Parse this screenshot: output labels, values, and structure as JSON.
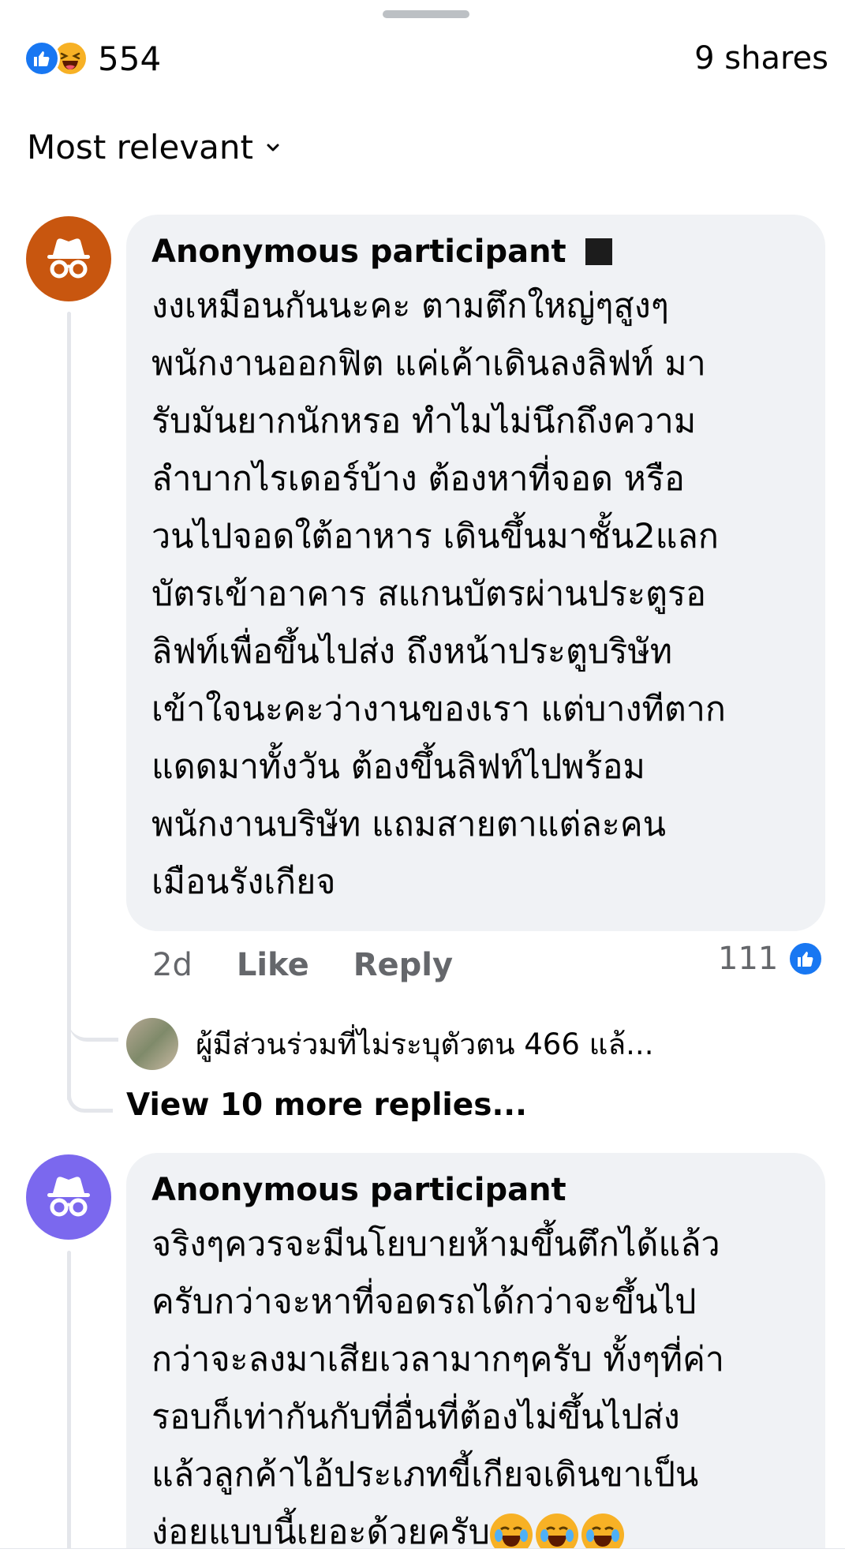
{
  "reactions": {
    "count": "554",
    "icons": [
      "like-icon",
      "haha-icon"
    ],
    "shares": "9 shares"
  },
  "sort": {
    "label": "Most relevant",
    "icon": "chevron-down-icon"
  },
  "comments": [
    {
      "author": "Anonymous participant",
      "avatar_color": "#c8560f",
      "text": "งงเหมือนกันนะคะ ตามตึกใหญ่ๆสูงๆ\nพนักงานออกฟิต แค่เค้าเดินลงลิฟท์ มา\nรับมันยากนักหรอ ทำไมไม่นึกถึงความ\nลำบากไรเดอร์บ้าง ต้องหาที่จอด หรือ\nวนไปจอดใต้อาหาร เดินขึ้นมาชั้น2แลก\nบัตรเข้าอาคาร สแกนบัตรผ่านประตูรอ\nลิฟท์เพื่อขึ้นไปส่ง ถึงหน้าประตูบริษัท\nเข้าใจนะคะว่างานของเรา แต่บางทีตาก\nแดดมาทั้งวัน ต้องขึ้นลิฟท์ไปพร้อม\nพนักงานบริษัท แถมสายตาแต่ละคน\nเมือนรังเกียจ",
      "time": "2d",
      "like_label": "Like",
      "reply_label": "Reply",
      "like_count": "111",
      "reply_preview": "ผู้มีส่วนร่วมที่ไม่ระบุตัวตน 466 แล้...",
      "view_more": "View 10 more replies..."
    },
    {
      "author": "Anonymous participant",
      "avatar_color": "#7b68ee",
      "text": "จริงๆควรจะมีนโยบายห้ามขึ้นตึกได้แล้ว\nครับกว่าจะหาที่จอดรถได้กว่าจะขึ้นไป\nกว่าจะลงมาเสียเวลามากๆครับ ทั้งๆที่ค่า\nรอบก็เท่ากันกับที่อื่นที่ต้องไม่ขึ้นไปส่ง\nแล้วลูกค้าไอ้ประเภทขี้เกียจเดินขาเป็น\nง่อยแบบนี้เยอะด้วยครับ"
    }
  ]
}
